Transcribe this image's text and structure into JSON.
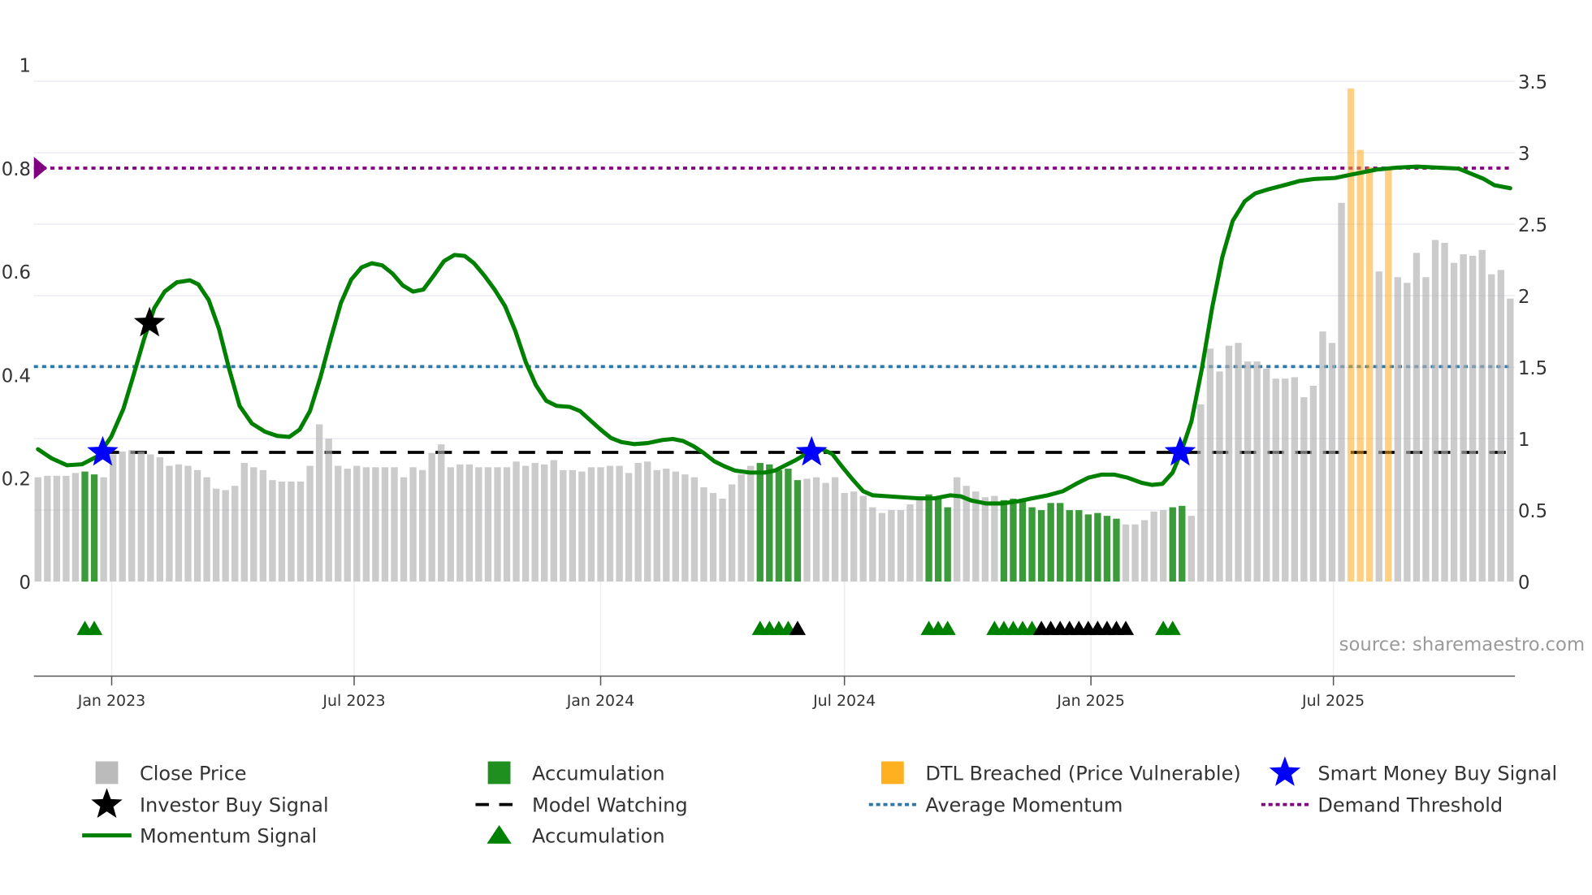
{
  "chart_data": {
    "type": "bar",
    "title": "",
    "start_date": "2022-11-07",
    "interval_days": 7,
    "left_axis": {
      "ylim": [
        0,
        1
      ],
      "ticks": [
        "0",
        "0.2",
        "0.4",
        "0.6",
        "0.8",
        "1"
      ],
      "tick_values": [
        0,
        0.2,
        0.4,
        0.6,
        0.8,
        1
      ]
    },
    "right_axis": {
      "ylim": [
        0,
        3.5
      ],
      "ticks": [
        "0",
        "0.5",
        "1",
        "1.5",
        "2",
        "2.5",
        "3",
        "3.5"
      ],
      "tick_values": [
        0,
        0.5,
        1,
        1.5,
        2,
        2.5,
        3,
        3.5
      ]
    },
    "x_ticks": [
      {
        "label": "Jan 2023",
        "date": "2023-01-01"
      },
      {
        "label": "Jul 2023",
        "date": "2023-07-01"
      },
      {
        "label": "Jan 2024",
        "date": "2024-01-01"
      },
      {
        "label": "Jul 2024",
        "date": "2024-07-01"
      },
      {
        "label": "Jan 2025",
        "date": "2025-01-01"
      },
      {
        "label": "Jul 2025",
        "date": "2025-07-01"
      }
    ],
    "close_price": [
      0.73,
      0.74,
      0.74,
      0.74,
      0.76,
      0.77,
      0.75,
      0.73,
      0.89,
      0.91,
      0.92,
      0.91,
      0.89,
      0.87,
      0.81,
      0.82,
      0.81,
      0.78,
      0.73,
      0.65,
      0.64,
      0.67,
      0.83,
      0.8,
      0.78,
      0.71,
      0.7,
      0.7,
      0.7,
      0.81,
      1.1,
      1.0,
      0.81,
      0.79,
      0.81,
      0.8,
      0.8,
      0.8,
      0.8,
      0.73,
      0.8,
      0.78,
      0.9,
      0.96,
      0.8,
      0.82,
      0.82,
      0.8,
      0.8,
      0.8,
      0.8,
      0.84,
      0.81,
      0.83,
      0.82,
      0.85,
      0.78,
      0.78,
      0.77,
      0.8,
      0.8,
      0.81,
      0.81,
      0.76,
      0.83,
      0.84,
      0.78,
      0.79,
      0.77,
      0.75,
      0.73,
      0.66,
      0.62,
      0.58,
      0.68,
      0.75,
      0.81,
      0.83,
      0.82,
      0.78,
      0.79,
      0.71,
      0.72,
      0.73,
      0.69,
      0.73,
      0.62,
      0.63,
      0.6,
      0.52,
      0.48,
      0.5,
      0.5,
      0.54,
      0.59,
      0.61,
      0.58,
      0.52,
      0.73,
      0.67,
      0.63,
      0.59,
      0.6,
      0.57,
      0.58,
      0.57,
      0.52,
      0.5,
      0.55,
      0.55,
      0.5,
      0.5,
      0.47,
      0.48,
      0.46,
      0.44,
      0.4,
      0.4,
      0.43,
      0.49,
      0.5,
      0.52,
      0.53,
      0.46,
      1.24,
      1.63,
      1.47,
      1.65,
      1.67,
      1.54,
      1.54,
      1.49,
      1.42,
      1.42,
      1.43,
      1.29,
      1.37,
      1.75,
      1.67,
      2.65,
      3.45,
      3.02,
      2.9,
      2.17,
      2.9,
      2.13,
      2.09,
      2.3,
      2.13,
      2.39,
      2.37,
      2.23,
      2.29,
      2.28,
      2.32,
      2.15,
      2.18,
      1.98
    ],
    "accumulation_weeks": [
      5,
      6,
      77,
      78,
      79,
      80,
      81,
      95,
      96,
      97,
      103,
      104,
      105,
      106,
      107,
      108,
      109,
      110,
      111,
      112,
      113,
      114,
      115,
      121,
      122
    ],
    "dtl_breached_weeks": [
      140,
      141,
      142,
      144
    ],
    "momentum": [
      [
        0,
        0.256
      ],
      [
        1.4,
        0.239
      ],
      [
        3.1,
        0.225
      ],
      [
        4.7,
        0.227
      ],
      [
        6.4,
        0.243
      ],
      [
        7.8,
        0.28
      ],
      [
        9.1,
        0.334
      ],
      [
        10.2,
        0.4
      ],
      [
        11.3,
        0.469
      ],
      [
        12.4,
        0.529
      ],
      [
        13.5,
        0.561
      ],
      [
        14.8,
        0.579
      ],
      [
        16.2,
        0.583
      ],
      [
        17.1,
        0.575
      ],
      [
        18.2,
        0.545
      ],
      [
        19.3,
        0.489
      ],
      [
        20.4,
        0.41
      ],
      [
        21.5,
        0.34
      ],
      [
        22.8,
        0.306
      ],
      [
        24.2,
        0.29
      ],
      [
        25.5,
        0.282
      ],
      [
        26.8,
        0.28
      ],
      [
        27.9,
        0.294
      ],
      [
        29.0,
        0.33
      ],
      [
        30.1,
        0.394
      ],
      [
        31.2,
        0.469
      ],
      [
        32.3,
        0.539
      ],
      [
        33.4,
        0.584
      ],
      [
        34.5,
        0.608
      ],
      [
        35.6,
        0.616
      ],
      [
        36.7,
        0.612
      ],
      [
        37.8,
        0.596
      ],
      [
        38.9,
        0.573
      ],
      [
        40.0,
        0.561
      ],
      [
        41.1,
        0.565
      ],
      [
        42.2,
        0.592
      ],
      [
        43.3,
        0.62
      ],
      [
        44.4,
        0.632
      ],
      [
        45.5,
        0.63
      ],
      [
        46.5,
        0.616
      ],
      [
        47.6,
        0.592
      ],
      [
        48.7,
        0.565
      ],
      [
        49.8,
        0.533
      ],
      [
        50.9,
        0.485
      ],
      [
        52.0,
        0.425
      ],
      [
        53.1,
        0.38
      ],
      [
        54.2,
        0.35
      ],
      [
        55.3,
        0.34
      ],
      [
        56.7,
        0.338
      ],
      [
        57.8,
        0.33
      ],
      [
        58.9,
        0.312
      ],
      [
        60.0,
        0.294
      ],
      [
        61.1,
        0.278
      ],
      [
        62.2,
        0.27
      ],
      [
        63.6,
        0.266
      ],
      [
        65.0,
        0.268
      ],
      [
        66.6,
        0.274
      ],
      [
        67.7,
        0.276
      ],
      [
        68.8,
        0.272
      ],
      [
        69.9,
        0.262
      ],
      [
        71.0,
        0.249
      ],
      [
        72.1,
        0.233
      ],
      [
        73.2,
        0.223
      ],
      [
        74.3,
        0.215
      ],
      [
        75.9,
        0.211
      ],
      [
        77.5,
        0.211
      ],
      [
        78.6,
        0.215
      ],
      [
        79.7,
        0.225
      ],
      [
        80.8,
        0.235
      ],
      [
        81.9,
        0.247
      ],
      [
        83.6,
        0.256
      ],
      [
        84.7,
        0.247
      ],
      [
        85.8,
        0.221
      ],
      [
        86.9,
        0.197
      ],
      [
        88.0,
        0.175
      ],
      [
        89.0,
        0.167
      ],
      [
        90.7,
        0.165
      ],
      [
        92.3,
        0.163
      ],
      [
        94.0,
        0.161
      ],
      [
        95.6,
        0.161
      ],
      [
        97.3,
        0.167
      ],
      [
        98.4,
        0.165
      ],
      [
        99.5,
        0.157
      ],
      [
        101.1,
        0.151
      ],
      [
        102.7,
        0.151
      ],
      [
        104.4,
        0.155
      ],
      [
        106.0,
        0.161
      ],
      [
        107.7,
        0.167
      ],
      [
        109.3,
        0.175
      ],
      [
        110.7,
        0.189
      ],
      [
        112.0,
        0.201
      ],
      [
        113.4,
        0.207
      ],
      [
        114.8,
        0.207
      ],
      [
        116.2,
        0.201
      ],
      [
        117.7,
        0.191
      ],
      [
        118.8,
        0.187
      ],
      [
        119.9,
        0.189
      ],
      [
        121.0,
        0.211
      ],
      [
        121.9,
        0.25
      ],
      [
        123.0,
        0.31
      ],
      [
        124.1,
        0.41
      ],
      [
        125.2,
        0.529
      ],
      [
        126.3,
        0.628
      ],
      [
        127.4,
        0.698
      ],
      [
        128.7,
        0.736
      ],
      [
        129.8,
        0.751
      ],
      [
        131.2,
        0.759
      ],
      [
        132.9,
        0.767
      ],
      [
        134.5,
        0.775
      ],
      [
        136.1,
        0.779
      ],
      [
        138.3,
        0.781
      ],
      [
        140.5,
        0.789
      ],
      [
        142.7,
        0.797
      ],
      [
        144.9,
        0.801
      ],
      [
        147.1,
        0.803
      ],
      [
        149.3,
        0.801
      ],
      [
        151.5,
        0.799
      ],
      [
        153.1,
        0.787
      ],
      [
        154.2,
        0.779
      ],
      [
        155.3,
        0.767
      ],
      [
        157,
        0.761
      ]
    ],
    "model_watching": {
      "value": 0.25,
      "from_week": 6.9
    },
    "average_momentum": 0.416,
    "demand_threshold": 0.8,
    "smart_money_buy_signals": [
      [
        6.9,
        0.25
      ],
      [
        82.5,
        0.25
      ],
      [
        121.8,
        0.25
      ]
    ],
    "investor_buy_signals": [
      [
        11.9,
        0.5
      ]
    ],
    "accumulation_markers": {
      "green": [
        5,
        6,
        77,
        78,
        79,
        80,
        95,
        96,
        97,
        102,
        103,
        104,
        105,
        106,
        120,
        121
      ],
      "black": [
        81,
        107,
        108,
        109,
        110,
        111,
        112,
        113,
        114,
        115,
        116
      ]
    },
    "legend": [
      {
        "label": "Close Price",
        "marker": "gray-square"
      },
      {
        "label": "Accumulation",
        "marker": "green-square"
      },
      {
        "label": "DTL Breached (Price Vulnerable)",
        "marker": "orange-square"
      },
      {
        "label": "Smart Money Buy Signal",
        "marker": "blue-star"
      },
      {
        "label": "Investor Buy Signal",
        "marker": "black-star"
      },
      {
        "label": "Model Watching",
        "marker": "black-dash"
      },
      {
        "label": "Average Momentum",
        "marker": "blue-dot"
      },
      {
        "label": "Demand Threshold",
        "marker": "purple-dot"
      },
      {
        "label": "Momentum Signal",
        "marker": "green-line"
      },
      {
        "label": "Accumulation",
        "marker": "green-triangle"
      }
    ],
    "legend_placement": "bottom",
    "source": "source: sharemaestro.com",
    "colors": {
      "close": "#bdbdbd",
      "accumulation": "#2e8b2e",
      "dtl": "#ffb22e",
      "momentum": "#008000",
      "smart_money": "#0000ff",
      "investor": "#000000",
      "avg_momentum": "#2e78a8",
      "demand": "#800080"
    }
  }
}
